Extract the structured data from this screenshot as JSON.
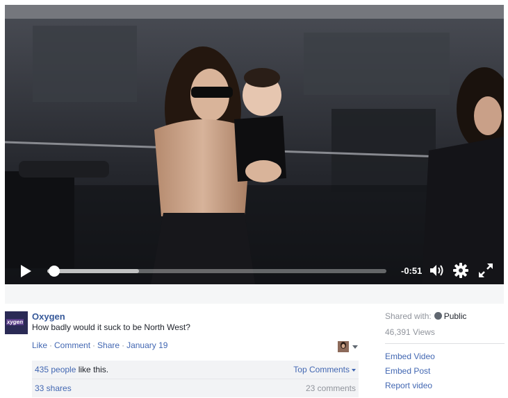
{
  "video": {
    "time_remaining": "-0:51",
    "progress": 0.02,
    "buffered": 0.27,
    "icons": [
      "play-icon",
      "volume-icon",
      "gear-icon",
      "fullscreen-icon"
    ]
  },
  "post": {
    "avatar_text": "xygen",
    "page_name": "Oxygen",
    "caption": "How badly would it suck to be North West?",
    "actions": {
      "like": "Like",
      "comment": "Comment",
      "share": "Share",
      "date": "January 19",
      "separator": "·"
    },
    "likes": {
      "count": "435 people",
      "suffix": " like this."
    },
    "top_comments": "Top Comments",
    "shares": "33 shares",
    "comments": "23 comments"
  },
  "side": {
    "shared_with_label": "Shared with:",
    "privacy": "Public",
    "views": "46,391 Views",
    "links": {
      "embed_video": "Embed Video",
      "embed_post": "Embed Post",
      "report_video": "Report video"
    }
  },
  "colors": {
    "link": "#4267b2",
    "page_name": "#365899",
    "muted": "#90949c",
    "panel": "#f2f3f5"
  }
}
